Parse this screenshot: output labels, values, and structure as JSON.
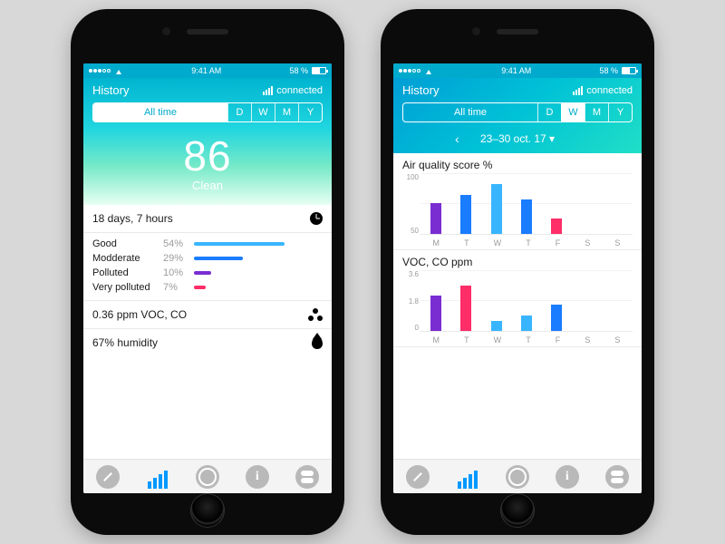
{
  "statusbar": {
    "time": "9:41 AM",
    "battery_pct": "58 %"
  },
  "header": {
    "title": "History",
    "connected_label": "connected"
  },
  "segments": {
    "alltime": "All time",
    "d": "D",
    "w": "W",
    "m": "M",
    "y": "Y"
  },
  "phoneA": {
    "score": "86",
    "score_label": "Clean",
    "duration": "18 days, 7 hours",
    "legend": [
      {
        "label": "Good",
        "pct": "54%",
        "width": 100,
        "color": "#39b5ff"
      },
      {
        "label": "Modderate",
        "pct": "29%",
        "width": 54,
        "color": "#1a7cff"
      },
      {
        "label": "Polluted",
        "pct": "10%",
        "width": 19,
        "color": "#7a2dd1"
      },
      {
        "label": "Very polluted",
        "pct": "7%",
        "width": 13,
        "color": "#ff2d68"
      }
    ],
    "voc_line": "0.36 ppm VOC, CO",
    "humidity_line": "67% humidity"
  },
  "phoneB": {
    "date_range": "23–30 oct. 17",
    "chevron": "▾"
  },
  "chart_data": [
    {
      "type": "bar",
      "title": "Air quality score %",
      "xlabel": "",
      "ylabel": "",
      "ylim": [
        0,
        100
      ],
      "yticks": [
        100,
        50
      ],
      "categories": [
        "M",
        "T",
        "W",
        "T",
        "F",
        "S",
        "S"
      ],
      "series": [
        {
          "name": "score",
          "values": [
            52,
            65,
            83,
            58,
            25,
            null,
            null
          ],
          "colors": [
            "#7a2dd1",
            "#1a7cff",
            "#39b5ff",
            "#1a7cff",
            "#ff2d68",
            "",
            ""
          ]
        }
      ]
    },
    {
      "type": "bar",
      "title": "VOC, CO ppm",
      "xlabel": "",
      "ylabel": "",
      "ylim": [
        0,
        3.6
      ],
      "yticks": [
        3.6,
        1.8,
        0.0
      ],
      "categories": [
        "M",
        "T",
        "W",
        "T",
        "F",
        "S",
        "S"
      ],
      "series": [
        {
          "name": "ppm",
          "values": [
            2.1,
            2.7,
            0.6,
            0.9,
            1.6,
            null,
            null
          ],
          "colors": [
            "#7a2dd1",
            "#ff2d68",
            "#39b5ff",
            "#39b5ff",
            "#1a7cff",
            "",
            ""
          ]
        }
      ]
    }
  ]
}
